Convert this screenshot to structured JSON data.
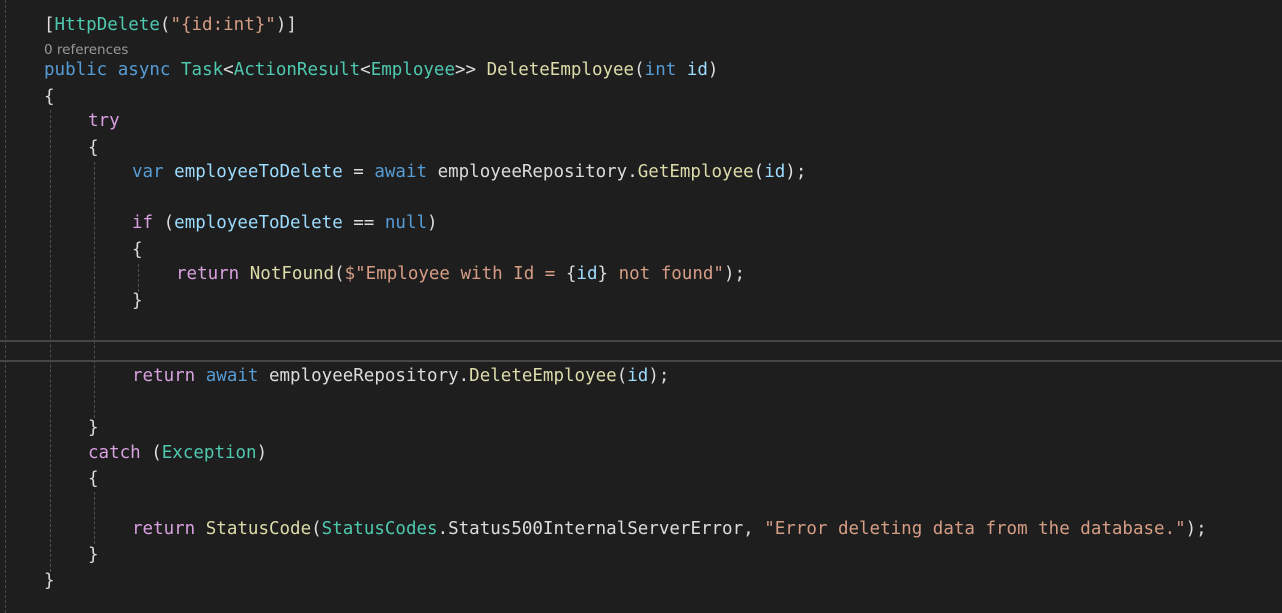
{
  "codelens": "0 references",
  "lines": {
    "l1": {
      "p1": "[",
      "p2": "HttpDelete",
      "p3": "(",
      "p4": "\"{id:int}\"",
      "p5": ")]"
    },
    "l2": {
      "p1": "public",
      "p2": " ",
      "p3": "async",
      "p4": " ",
      "p5": "Task",
      "p6": "<",
      "p7": "ActionResult",
      "p8": "<",
      "p9": "Employee",
      "p10": ">> ",
      "p11": "DeleteEmployee",
      "p12": "(",
      "p13": "int",
      "p14": " ",
      "p15": "id",
      "p16": ")"
    },
    "l3": {
      "p1": "{"
    },
    "l4": {
      "p1": "try"
    },
    "l5": {
      "p1": "{"
    },
    "l6": {
      "p1": "var",
      "p2": " ",
      "p3": "employeeToDelete",
      "p4": " = ",
      "p5": "await",
      "p6": " employeeRepository.",
      "p7": "GetEmployee",
      "p8": "(",
      "p9": "id",
      "p10": ");"
    },
    "l7": {
      "p1": "if",
      "p2": " (",
      "p3": "employeeToDelete",
      "p4": " == ",
      "p5": "null",
      "p6": ")"
    },
    "l8": {
      "p1": "{"
    },
    "l9": {
      "p1": "return",
      "p2": " ",
      "p3": "NotFound",
      "p4": "(",
      "p5": "$\"Employee with Id = ",
      "p6": "{",
      "p7": "id",
      "p8": "}",
      "p9": " not found\"",
      "p10": ");"
    },
    "l10": {
      "p1": "}"
    },
    "l11": {
      "p1": "return",
      "p2": " ",
      "p3": "await",
      "p4": " employeeRepository.",
      "p5": "DeleteEmployee",
      "p6": "(",
      "p7": "id",
      "p8": ");"
    },
    "l12": {
      "p1": "}"
    },
    "l13": {
      "p1": "catch",
      "p2": " (",
      "p3": "Exception",
      "p4": ")"
    },
    "l14": {
      "p1": "{"
    },
    "l15": {
      "p1": "return",
      "p2": " ",
      "p3": "StatusCode",
      "p4": "(",
      "p5": "StatusCodes",
      "p6": ".Status500InternalServerError, ",
      "p7": "\"Error deleting data from the database.\"",
      "p8": ");"
    },
    "l16": {
      "p1": "}"
    },
    "l17": {
      "p1": "}"
    }
  }
}
